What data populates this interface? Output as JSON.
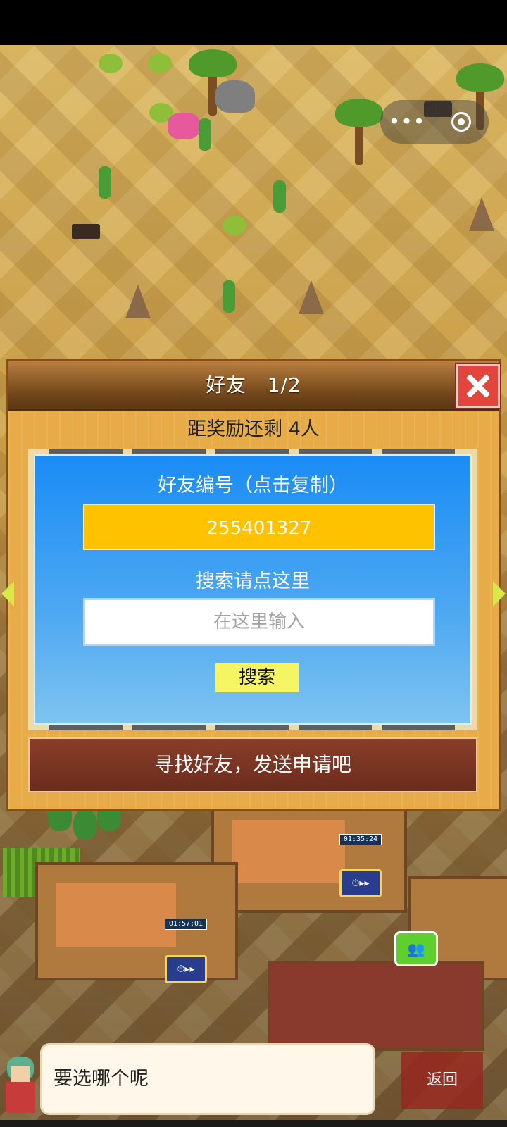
{
  "capsule": {
    "more_icon": "more-dots-icon",
    "close_icon": "target-circle-icon",
    "dots": "•••"
  },
  "dialog": {
    "title": "好友   1/2",
    "close_icon": "close-x-icon",
    "reward_text": "距奖励还剩 4人",
    "friend_id_label": "好友编号（点击复制）",
    "friend_id": "255401327",
    "search_label": "搜索请点这里",
    "search_placeholder": "在这里输入",
    "search_button": "搜索",
    "find_friends_button": "寻找好友，发送申请吧"
  },
  "hud": {
    "speech_text": "要选哪个呢",
    "back_button": "返回",
    "timers": [
      "01:35:24",
      "01:57:01"
    ]
  },
  "colors": {
    "accent_yellow": "#ffc200",
    "panel_blue": "#1a8cf5",
    "close_red": "#e2453c",
    "button_brown": "#6b2c1c"
  }
}
